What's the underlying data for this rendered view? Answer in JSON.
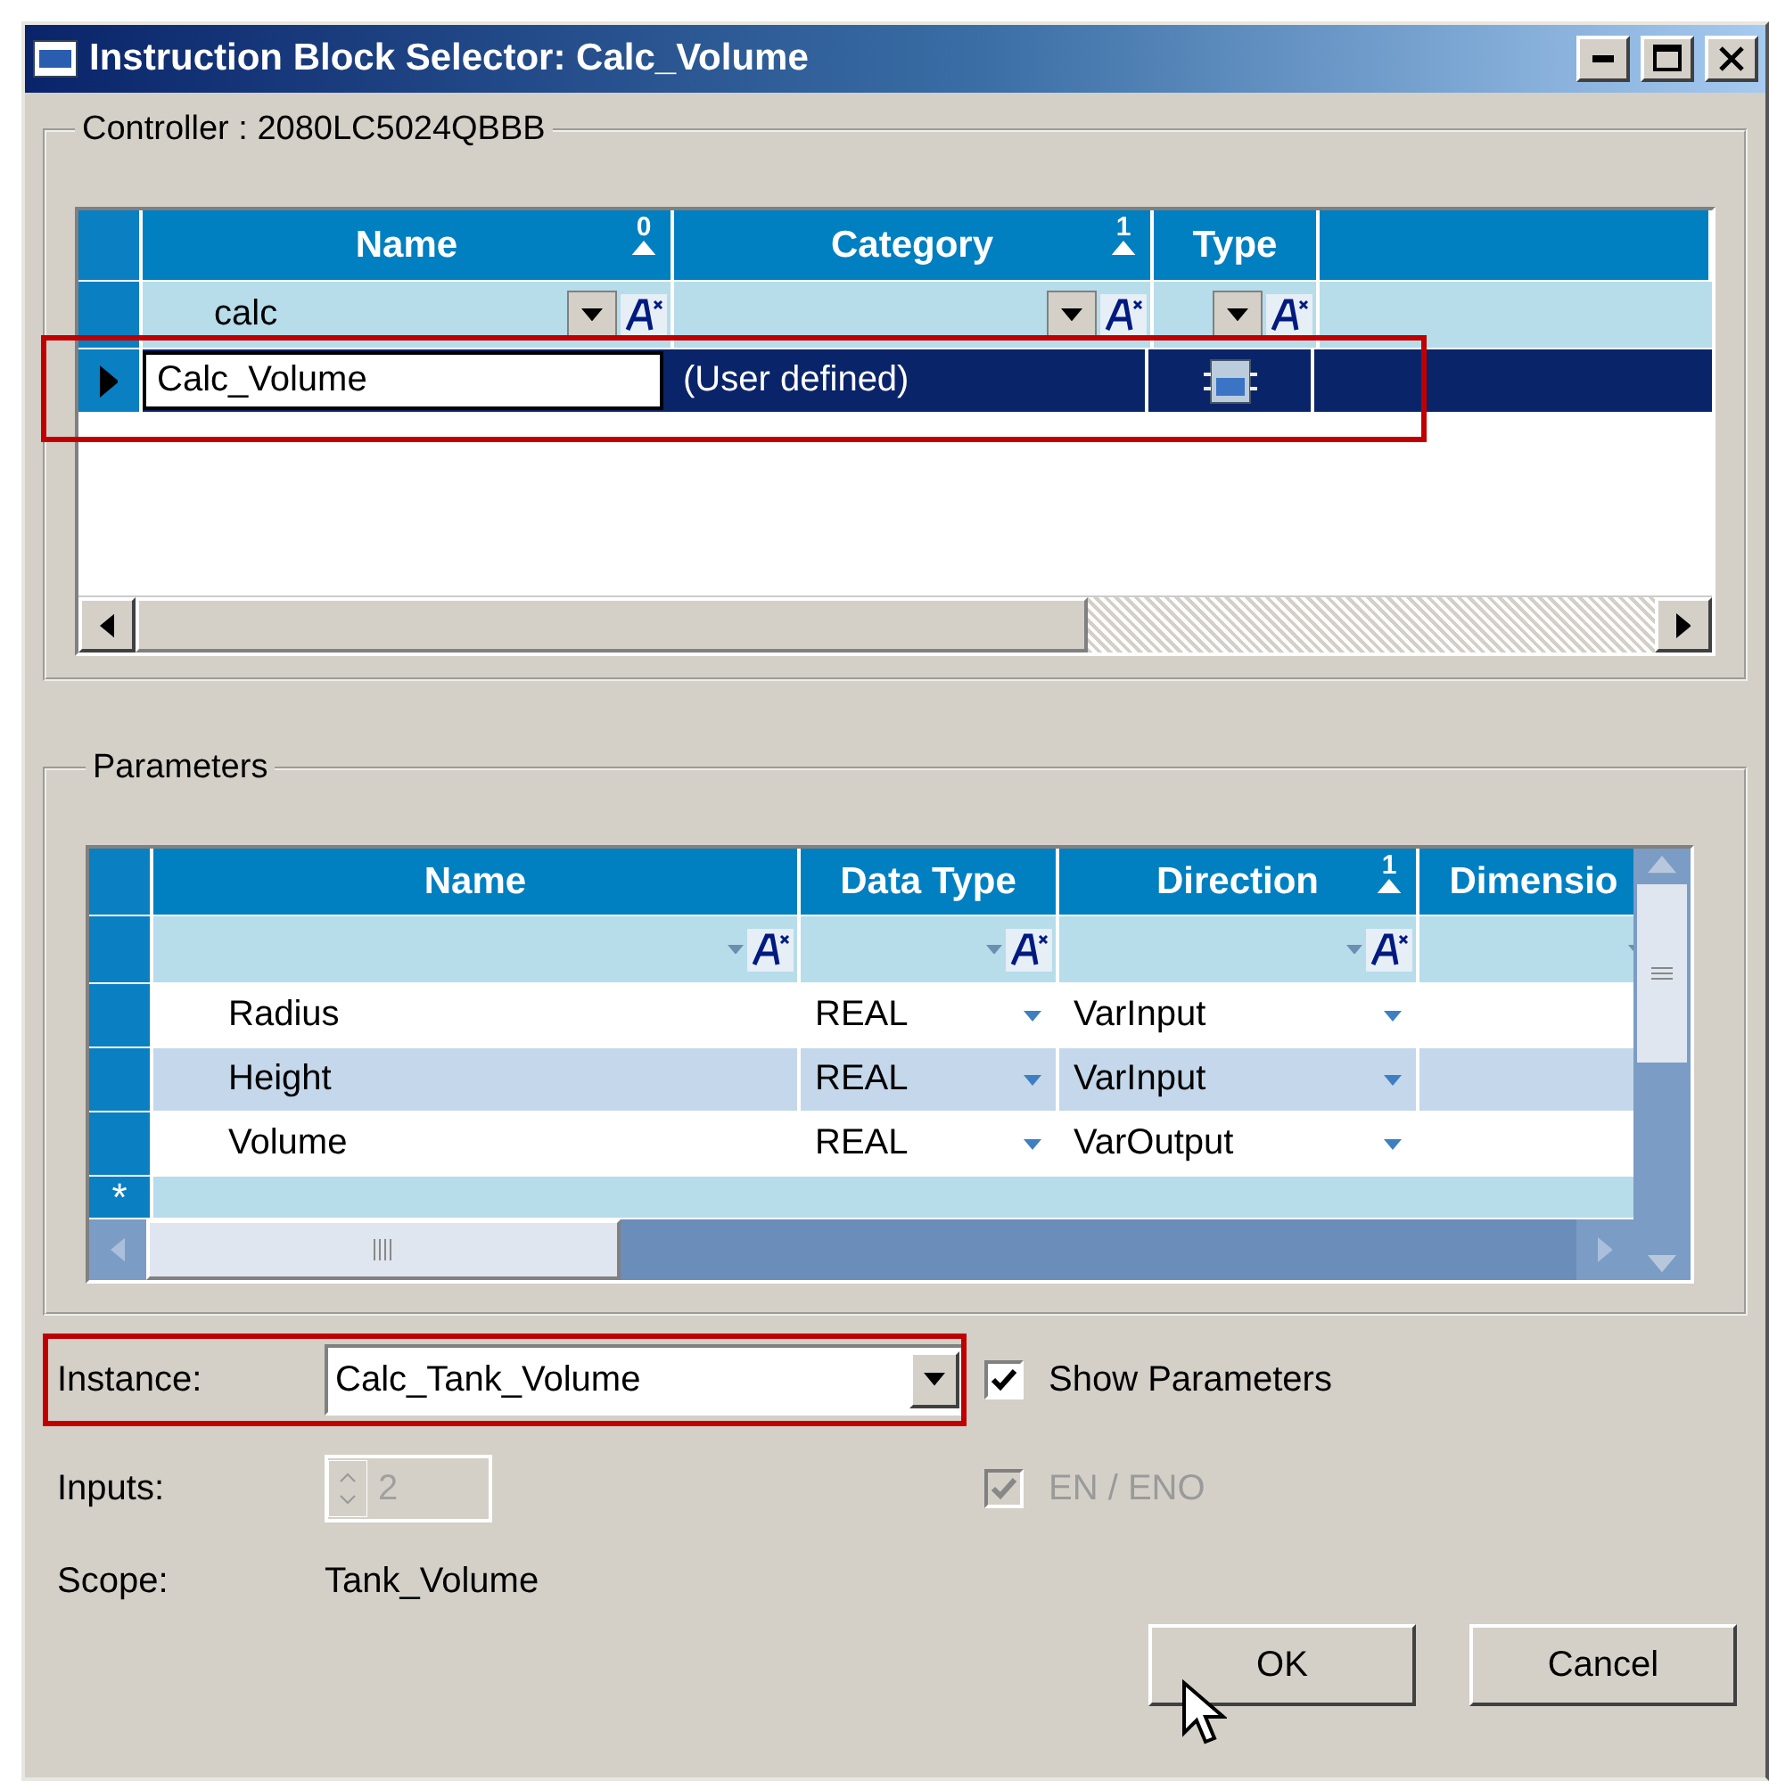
{
  "window": {
    "title": "Instruction Block Selector: Calc_Volume"
  },
  "controller": {
    "label": "Controller : 2080LC5024QBBB",
    "columns": [
      {
        "label": "Name",
        "sort_index": "0",
        "filter": "calc"
      },
      {
        "label": "Category",
        "sort_index": "1"
      },
      {
        "label": "Type"
      }
    ],
    "rows": [
      {
        "name": "Calc_Volume",
        "category": "(User defined)",
        "selected": true,
        "highlighted": true
      }
    ]
  },
  "parameters": {
    "label": "Parameters",
    "columns": [
      {
        "label": "Name"
      },
      {
        "label": "Data Type"
      },
      {
        "label": "Direction",
        "sort_index": "1"
      },
      {
        "label": "Dimensio"
      }
    ],
    "rows": [
      {
        "name": "Radius",
        "data_type": "REAL",
        "direction": "VarInput",
        "selected": false
      },
      {
        "name": "Height",
        "data_type": "REAL",
        "direction": "VarInput",
        "selected": true
      },
      {
        "name": "Volume",
        "data_type": "REAL",
        "direction": "VarOutput",
        "selected": false
      }
    ],
    "new_row_marker": "*"
  },
  "instance": {
    "label": "Instance:",
    "value": "Calc_Tank_Volume",
    "highlighted": true
  },
  "inputs": {
    "label": "Inputs:",
    "value": "2",
    "disabled": true
  },
  "scope": {
    "label": "Scope:",
    "value": "Tank_Volume"
  },
  "options": [
    {
      "label": "Show Parameters",
      "checked": true,
      "disabled": false
    },
    {
      "label": "EN / ENO",
      "checked": true,
      "disabled": true
    }
  ],
  "buttons": [
    "OK",
    "Cancel"
  ]
}
